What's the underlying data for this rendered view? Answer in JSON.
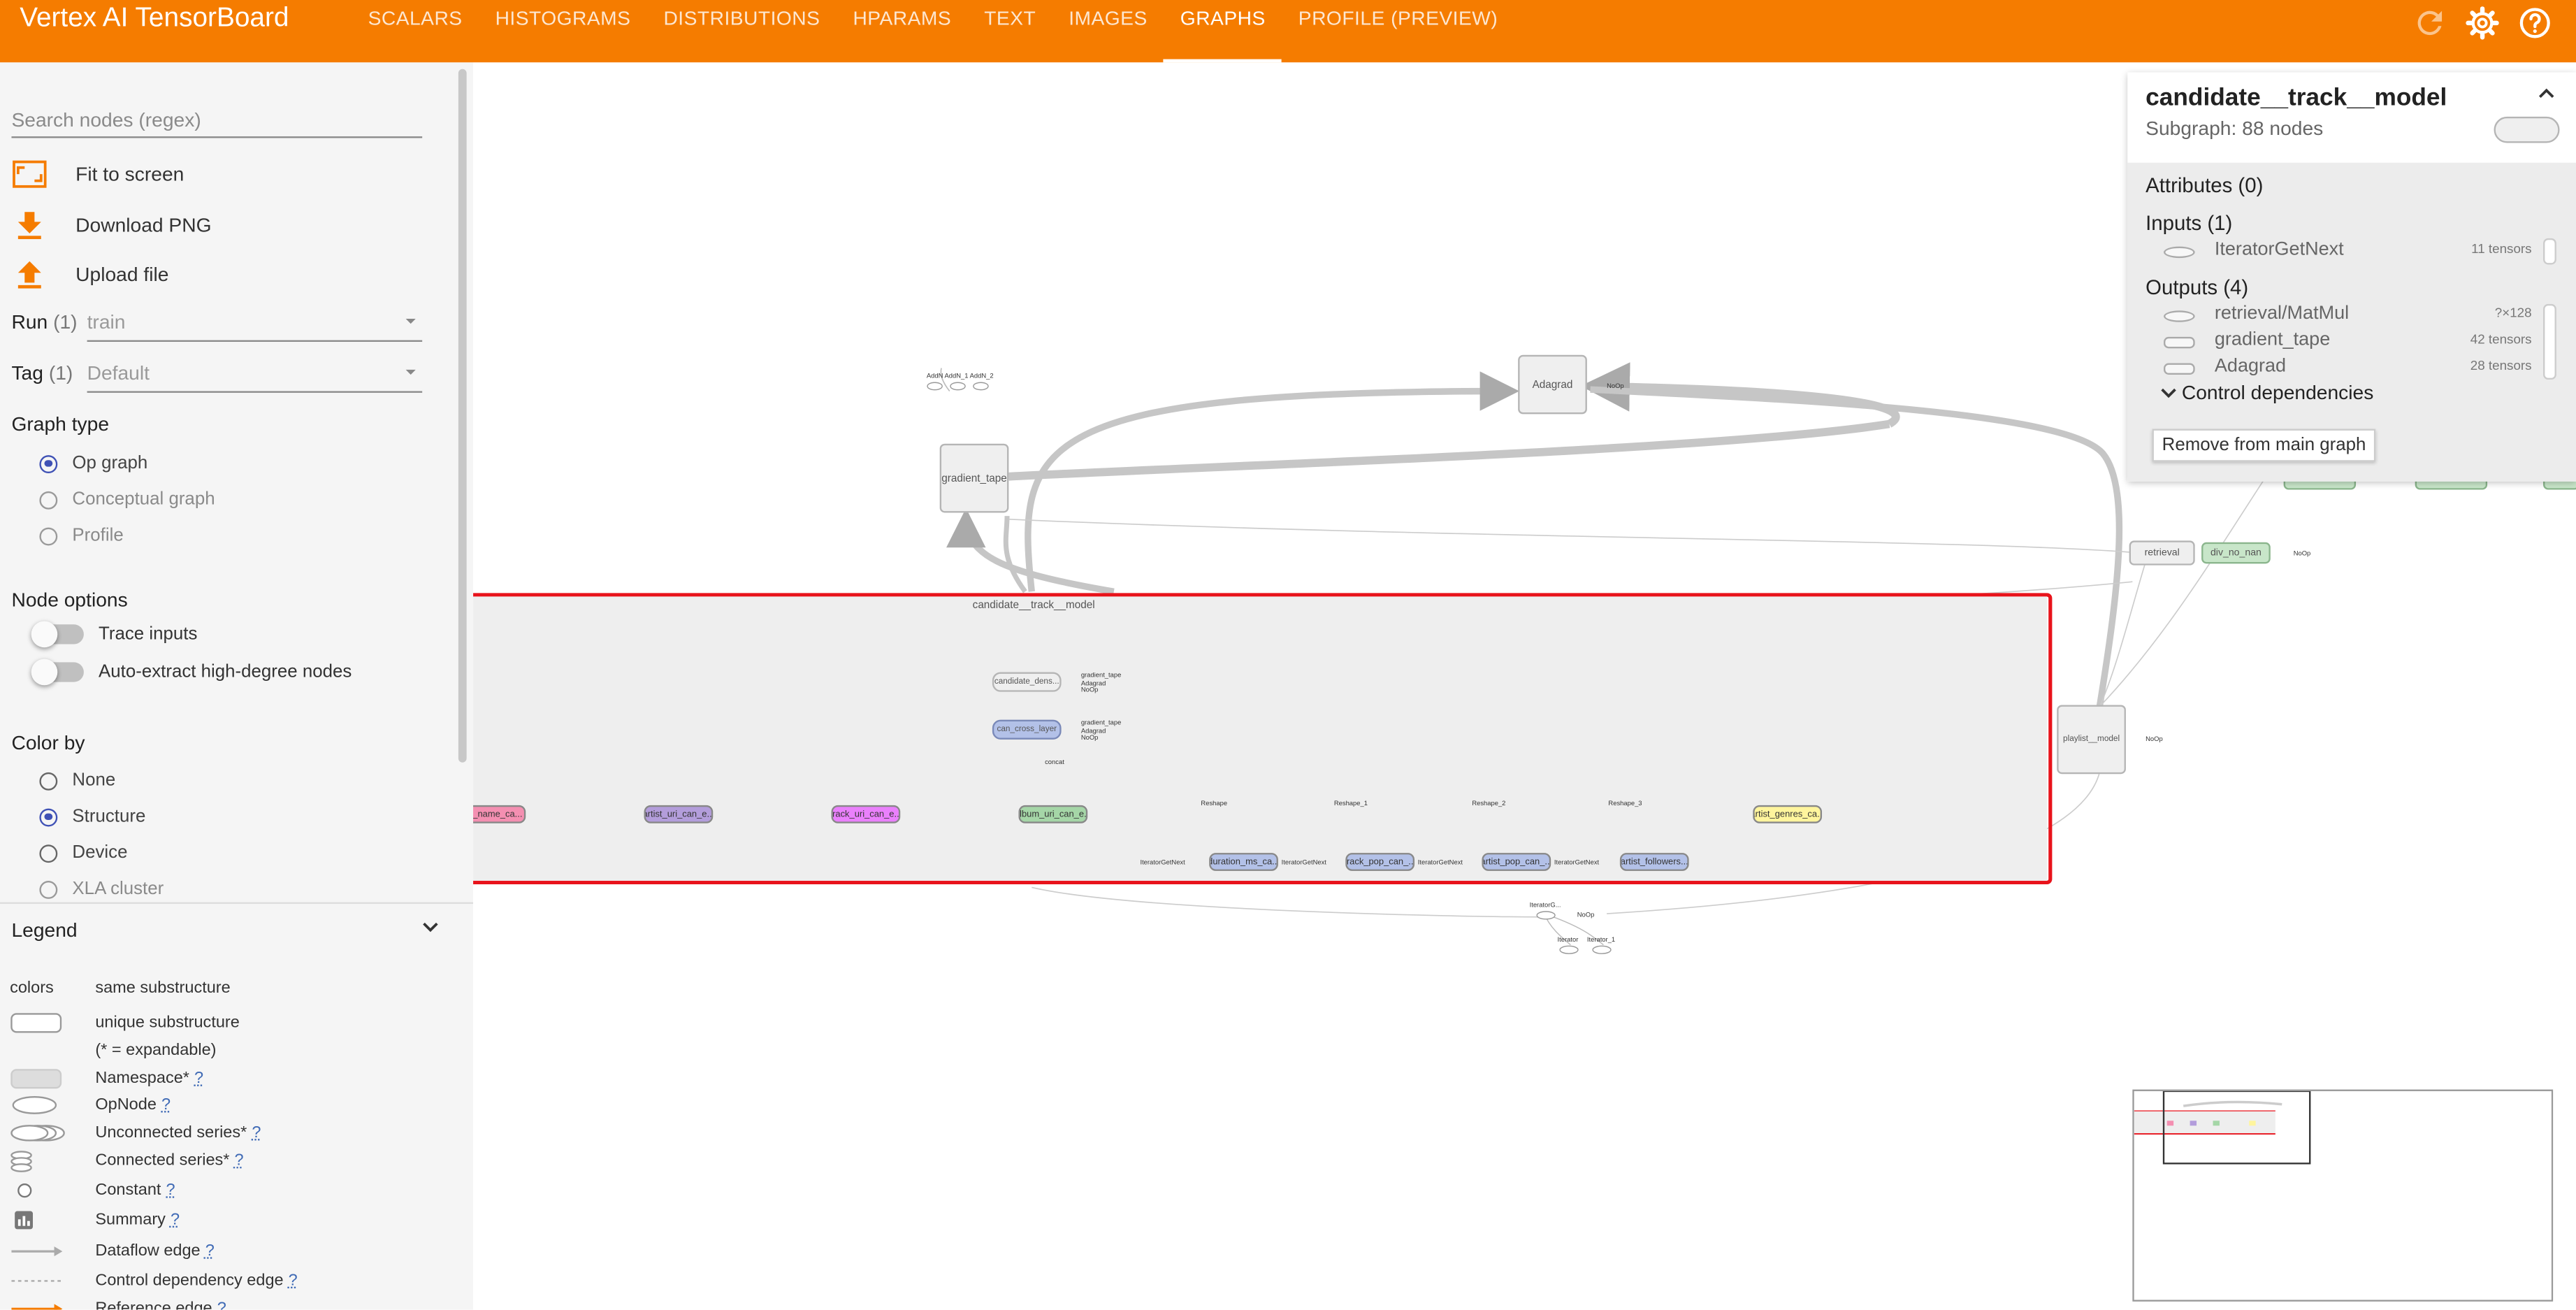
{
  "app": {
    "title": "Vertex AI TensorBoard"
  },
  "nav": {
    "tabs": [
      "SCALARS",
      "HISTOGRAMS",
      "DISTRIBUTIONS",
      "HPARAMS",
      "TEXT",
      "IMAGES",
      "GRAPHS",
      "PROFILE (PREVIEW)"
    ],
    "active_tab": "GRAPHS"
  },
  "topbar": {
    "icons": [
      "refresh-icon",
      "settings-icon",
      "help-icon"
    ]
  },
  "sidebar": {
    "search_placeholder": "Search nodes (regex)",
    "actions": {
      "fit": "Fit to screen",
      "download": "Download PNG",
      "upload": "Upload file"
    },
    "run": {
      "label": "Run",
      "count": "(1)",
      "value": "train"
    },
    "tag": {
      "label": "Tag",
      "count": "(1)",
      "value": "Default"
    },
    "graph_type": {
      "title": "Graph type",
      "options": [
        "Op graph",
        "Conceptual graph",
        "Profile"
      ],
      "selected": "Op graph"
    },
    "node_options": {
      "title": "Node options",
      "trace": "Trace inputs",
      "auto_extract": "Auto-extract high-degree nodes"
    },
    "color_by": {
      "title": "Color by",
      "options": [
        "None",
        "Structure",
        "Device",
        "XLA cluster"
      ],
      "selected": "Structure"
    }
  },
  "legend": {
    "title": "Legend",
    "colors_label": "colors",
    "rows": [
      {
        "text": "same substructure"
      },
      {
        "text": "unique substructure"
      },
      {
        "text": "(* = expandable)"
      },
      {
        "text": "Namespace*",
        "help": "?"
      },
      {
        "text": "OpNode",
        "help": "?"
      },
      {
        "text": "Unconnected series*",
        "help": "?"
      },
      {
        "text": "Connected series*",
        "help": "?"
      },
      {
        "text": "Constant",
        "help": "?"
      },
      {
        "text": "Summary",
        "help": "?"
      },
      {
        "text": "Dataflow edge",
        "help": "?"
      },
      {
        "text": "Control dependency edge",
        "help": "?"
      },
      {
        "text": "Reference edge",
        "help": "?"
      }
    ]
  },
  "graph": {
    "top_nodes": {
      "adds": [
        "AddN",
        "AddN_1",
        "AddN_2"
      ],
      "gradient_tape": "gradient_tape",
      "adagrad": "Adagrad",
      "noop": "NoOp"
    },
    "right_nodes": {
      "retrieval": "retrieval",
      "div_no_nan": "div_no_nan",
      "playlist_model": "playlist__model",
      "noop": "NoOp"
    },
    "subgraph": {
      "title": "candidate__track__model",
      "stack": {
        "dense": "candidate_dens...",
        "cross": "can_cross_layer",
        "concat": "concat"
      },
      "stack_side": [
        "gradient_tape",
        "Adagrad",
        "NoOp"
      ],
      "top_row": [
        {
          "label": "am_name_ca...",
          "color": "#f48fb1"
        },
        {
          "label": "artist_uri_can_e...",
          "color": "#b39ddb"
        },
        {
          "label": "track_uri_can_e...",
          "color": "#ea80fc"
        },
        {
          "label": "album_uri_can_e...",
          "color": "#a5d6a7"
        },
        {
          "label": "artist_genres_ca...",
          "color": "#fff59d"
        }
      ],
      "bottom_row": [
        {
          "label": "duration_ms_ca...",
          "color": "#b3c1e8"
        },
        {
          "label": "track_pop_can_...",
          "color": "#b3c1e8"
        },
        {
          "label": "artist_pop_can_...",
          "color": "#b3c1e8"
        },
        {
          "label": "artist_followers...",
          "color": "#b3c1e8"
        }
      ],
      "small_labels": {
        "iterator": "IteratorGetNext",
        "shape": "shape",
        "reshape": [
          "Reshape",
          "Reshape_1",
          "Reshape_2",
          "Reshape_3"
        ]
      }
    },
    "bottom_nodes": {
      "iterator_getnext": "IteratorG...",
      "iterator": "Iterator",
      "iterator_1": "Iterator_1",
      "noop": "NoOp"
    },
    "highlight_color": "#e8131b"
  },
  "info_card": {
    "title": "candidate__track__model",
    "subtitle": "Subgraph: 88 nodes",
    "attributes": "Attributes (0)",
    "inputs": {
      "label": "Inputs (1)",
      "items": [
        {
          "name": "IteratorGetNext",
          "meta": "11 tensors"
        }
      ]
    },
    "outputs": {
      "label": "Outputs (4)",
      "items": [
        {
          "name": "retrieval/MatMul",
          "meta": "?×128"
        },
        {
          "name": "gradient_tape",
          "meta": "42 tensors"
        },
        {
          "name": "Adagrad",
          "meta": "28 tensors"
        }
      ]
    },
    "control_deps": "Control dependencies",
    "remove_button": "Remove from main graph"
  }
}
